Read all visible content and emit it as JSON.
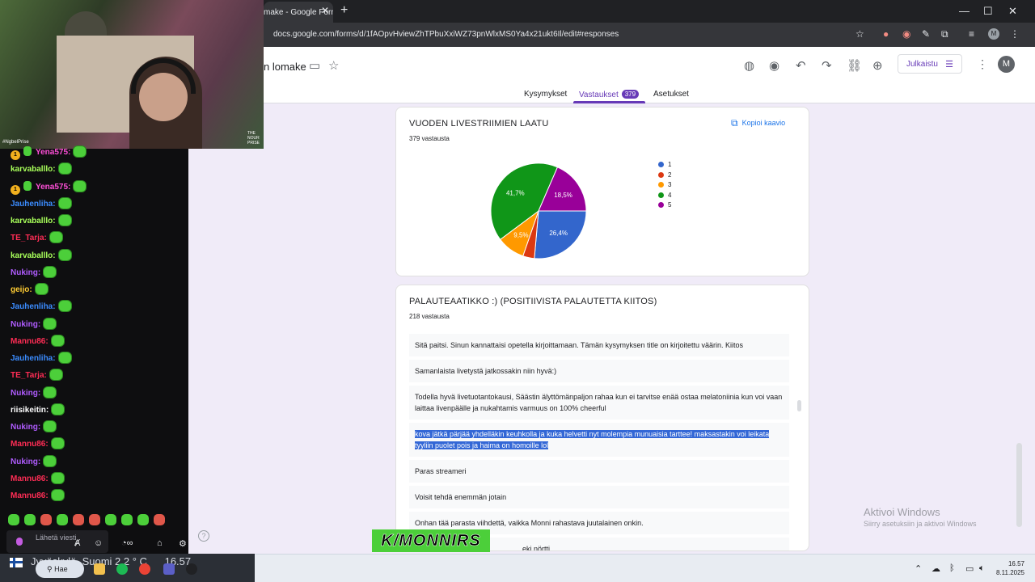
{
  "browser": {
    "tab_title": "make - Google Form",
    "url": "docs.google.com/forms/d/1fAOpvHviewZhTPbuXxiWZ73pnWlxMS0Ya4x21ukt6Il/edit#responses",
    "profile_letter": "M"
  },
  "form": {
    "title_fragment": "n lomake",
    "publish_label": "Julkaistu",
    "account_letter": "M",
    "tabs": [
      {
        "label": "Kysymykset"
      },
      {
        "label": "Vastaukset",
        "count": "379"
      },
      {
        "label": "Asetukset"
      }
    ]
  },
  "chart_card": {
    "title": "VUODEN LIVESTRIIMIEN LAATU",
    "responses": "379 vastausta",
    "copy_label": "Kopioi kaavio"
  },
  "chart_data": {
    "type": "pie",
    "title": "VUODEN LIVESTRIIMIEN LAATU",
    "categories": [
      "1",
      "2",
      "3",
      "4",
      "5"
    ],
    "values": [
      26.4,
      3.9,
      9.5,
      41.7,
      18.5
    ],
    "labels": [
      "26,4%",
      "",
      "9,5%",
      "41,7%",
      "18,5%"
    ],
    "colors": [
      "#3366cc",
      "#dc3912",
      "#ff9900",
      "#109618",
      "#990099"
    ],
    "legend_position": "right"
  },
  "text_card": {
    "title": "PALAUTEAATIKKO :) (POSITIIVISTA PALAUTETTA KIITOS)",
    "responses": "218 vastausta",
    "items": [
      "Sitä paitsi. Sinun kannattaisi opetella kirjoittamaan. Tämän kysymyksen title on kirjoitettu väärin. Kiitos",
      "Samanlaista livetystä jatkossakin niin hyvä:)",
      "Todella hyvä livetuotantokausi, Säästin älyttömänpaljon rahaa kun ei tarvitse enää ostaa melatoniinia kun voi vaan laittaa livenpäälle ja nukahtamis varmuus on 100% cheerful",
      "kova jätkä pärjää yhdelläkin keuhkolla ja kuka helvetti nyt molempia munuaisia tarttee! maksastakin voi leikata tyyliin puolet pois ja haima on homoille lol",
      "Paras streameri",
      "Voisit tehdä enemmän jotain",
      "Onhan tää parasta viihdettä, vaikka Monni rahastava juutalainen onkin."
    ],
    "last_fragment": "eki nörtti"
  },
  "windows_watermark": {
    "line1": "Aktivoi Windows",
    "line2": "Siirry asetuksiin ja aktivoi Windows"
  },
  "stream": {
    "cam_label": "#NgbelPrise",
    "cam_badge": "THE NOUR PRISE",
    "chat": [
      {
        "user": "Yena575",
        "color": "#ff4fd8",
        "badges": true
      },
      {
        "user": "karvaballlo",
        "color": "#a8ff5a",
        "badges": false
      },
      {
        "user": "Yena575",
        "color": "#ff4fd8",
        "badges": true
      },
      {
        "user": "Jauhenliha",
        "color": "#3b8cff",
        "badges": false
      },
      {
        "user": "karvaballlo",
        "color": "#a8ff5a",
        "badges": false
      },
      {
        "user": "TE_Tarja",
        "color": "#ff2d55",
        "badges": false
      },
      {
        "user": "karvaballlo",
        "color": "#a8ff5a",
        "badges": false
      },
      {
        "user": "Nuking",
        "color": "#b05cff",
        "badges": false
      },
      {
        "user": "geijo",
        "color": "#ffcc33",
        "badges": false
      },
      {
        "user": "Jauhenliha",
        "color": "#3b8cff",
        "badges": false
      },
      {
        "user": "Nuking",
        "color": "#b05cff",
        "badges": false
      },
      {
        "user": "Mannu86",
        "color": "#ff2d55",
        "badges": false
      },
      {
        "user": "Jauhenliha",
        "color": "#3b8cff",
        "badges": false
      },
      {
        "user": "TE_Tarja",
        "color": "#ff2d55",
        "badges": false
      },
      {
        "user": "Nuking",
        "color": "#b05cff",
        "badges": false
      },
      {
        "user": "riisikeitin",
        "color": "#ffffff",
        "badges": false
      },
      {
        "user": "Nuking",
        "color": "#b05cff",
        "badges": false
      },
      {
        "user": "Mannu86",
        "color": "#ff2d55",
        "badges": false
      },
      {
        "user": "Nuking",
        "color": "#b05cff",
        "badges": false
      },
      {
        "user": "Mannu86",
        "color": "#ff2d55",
        "badges": false
      },
      {
        "user": "Mannu86",
        "color": "#ff2d55",
        "badges": false
      }
    ],
    "chat_placeholder": "Lähetä viesti",
    "logo_text": "K/MONNIRS"
  },
  "taskbar": {
    "weather": "Jyväskylä, Suomi   2,2 ° C",
    "temp_right": "16.57",
    "search_label": "Hae",
    "time": "16.57",
    "date": "8.11.2025"
  }
}
